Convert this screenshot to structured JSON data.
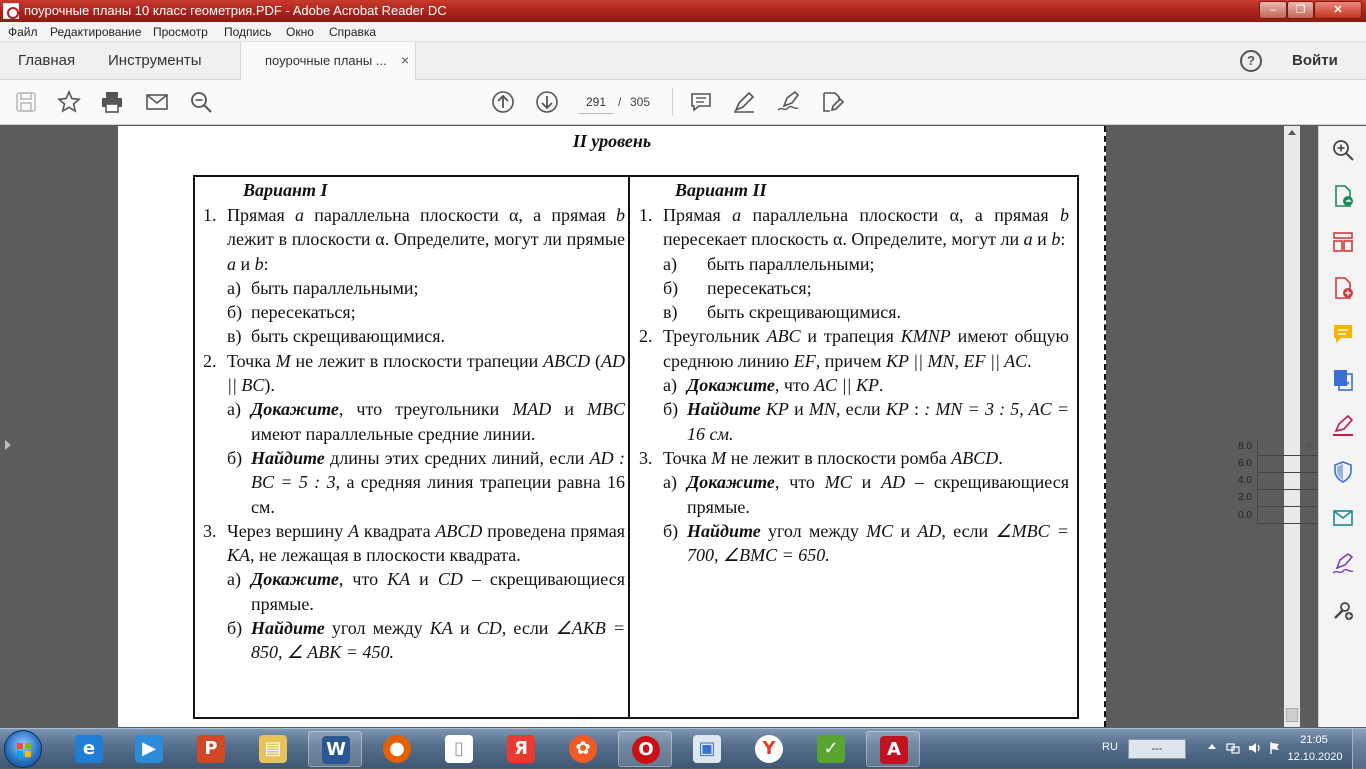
{
  "window": {
    "title": "поурочные планы 10 класс геометрия.PDF - Adobe Acrobat Reader DC",
    "min_symbol": "‒",
    "max_symbol": "❐",
    "close_symbol": "✕"
  },
  "menu": [
    "Файл",
    "Редактирование",
    "Просмотр",
    "Подпись",
    "Окно",
    "Справка"
  ],
  "tabs": {
    "home": "Главная",
    "tools": "Инструменты",
    "document": "поурочные планы ...",
    "close_symbol": "×",
    "help_symbol": "?",
    "signin": "Войти"
  },
  "toolbar": {
    "page_current": "291",
    "page_separator": "/",
    "page_total": "305"
  },
  "document": {
    "level_title": "II уровень",
    "variant1": {
      "heading": "Вариант I",
      "task1": {
        "num": "1.",
        "p1": "Прямая ",
        "a": "a",
        "p2": " параллельна плоскости α, а прямая ",
        "b": "b",
        "p3": " лежит в плоскости α. Определите, могут ли прямые ",
        "a2": "a",
        "p4": " и ",
        "b2": "b",
        "p5": ":",
        "subs": [
          {
            "letter": "а)",
            "text": "быть параллельными;"
          },
          {
            "letter": "б)",
            "text": "пересекаться;"
          },
          {
            "letter": "в)",
            "text": "быть скрещивающимися."
          }
        ]
      },
      "task2": {
        "num": "2.",
        "p1": "Точка ",
        "m": "M",
        "p2": " не лежит в плоскости трапеции ",
        "abcd": "ABCD",
        "p3": " (",
        "ad_bc": "AD || BC",
        "p4": ").",
        "sub_a_letter": "а)",
        "sub_a_verb": "Докажите",
        "sub_a_p1": ", что треугольники ",
        "mad": "MAD",
        "sub_a_p2": " и ",
        "mbc": "MBC",
        "sub_a_p3": " имеют параллельные средние линии.",
        "sub_b_letter": "б)",
        "sub_b_verb": "Найдите",
        "sub_b_p1": " длины этих средних линий, если ",
        "ratio": "AD : BC = 5 : 3",
        "sub_b_p2": ", а средняя линия трапеции равна 16 см."
      },
      "task3": {
        "num": "3.",
        "p1": "Через вершину ",
        "a": "A",
        "p2": " квадрата ",
        "abcd": "ABCD",
        "p3": " проведена прямая ",
        "ka": "KA",
        "p4": ", не лежащая в плоскости квадрата.",
        "sub_a_letter": "а)",
        "sub_a_verb": "Докажите",
        "sub_a_p1": ", что ",
        "ka2": "KA",
        "sub_a_p2": " и ",
        "cd": "CD",
        "sub_a_p3": " – скрещивающиеся прямые.",
        "sub_b_letter": "б)",
        "sub_b_verb": "Найдите",
        "sub_b_p1": " угол между ",
        "ka3": "KA",
        "sub_b_p2": " и ",
        "cd2": "CD",
        "sub_b_p3": ", если ",
        "angles": "∠AKB = 850, ∠ ABK = 450."
      }
    },
    "variant2": {
      "heading": "Вариант II",
      "task1": {
        "num": "1.",
        "p1": "Прямая ",
        "a": "a",
        "p2": " параллельна плоскости α, а прямая ",
        "b": "b",
        "p3": " пересекает плоскость α. Определите, могут ли ",
        "a2": "a",
        "p4": " и ",
        "b2": "b",
        "p5": ":",
        "subs": [
          {
            "letter": "а)",
            "text": "быть параллельными;"
          },
          {
            "letter": "б)",
            "text": "пересекаться;"
          },
          {
            "letter": "в)",
            "text": "быть скрещивающимися."
          }
        ]
      },
      "task2": {
        "num": "2.",
        "p1": "Треугольник ",
        "abc": "ABC",
        "p2": " и трапеция ",
        "kmnp": "KMNP",
        "p3": " имеют общую среднюю линию ",
        "ef": "EF",
        "p4": ", причем ",
        "kp_mn": "KP || MN, EF || AC",
        "p5": ".",
        "sub_a_letter": "а)",
        "sub_a_verb": "Докажите",
        "sub_a_p1": ", что ",
        "ac_kp": "AC || KP",
        "sub_a_p2": ".",
        "sub_b_letter": "б)",
        "sub_b_verb": "Найдите",
        "sub_b_p1": " ",
        "kp": "KP",
        "sub_b_p2": " и ",
        "mn": "MN",
        "sub_b_p3": ", если ",
        "kp2": "KP",
        "sub_b_p4": " : ",
        "ratio": ": MN = 3 : 5, AC = 16 см."
      },
      "task3": {
        "num": "3.",
        "p1": "Точка ",
        "m": "M",
        "p2": " не лежит в плоскости ромба ",
        "abcd": "ABCD",
        "p3": ".",
        "sub_a_letter": "а)",
        "sub_a_verb": "Докажите",
        "sub_a_p1": ", что ",
        "mc": "MC",
        "sub_a_p2": " и ",
        "ad": "AD",
        "sub_a_p3": " – скрещивающиеся прямые.",
        "sub_b_letter": "б)",
        "sub_b_verb": "Найдите",
        "sub_b_p1": " угол между ",
        "mc2": "MC",
        "sub_b_p2": " и ",
        "ad2": "AD",
        "sub_b_p3": ", если ",
        "angles": "∠MBC = 700, ∠BMC = 650."
      }
    }
  },
  "mini_chart": {
    "ticks": [
      "8.0",
      "6.0",
      "4.0",
      "2.0",
      "0.0"
    ]
  },
  "taskbar": {
    "lang": "RU",
    "tray_box": "---",
    "time": "21:05",
    "date": "12.10.2020"
  },
  "colors": {
    "titlebar": "#a8231a",
    "taskbar": "#56708e",
    "acrobat_red": "#c1121f"
  }
}
